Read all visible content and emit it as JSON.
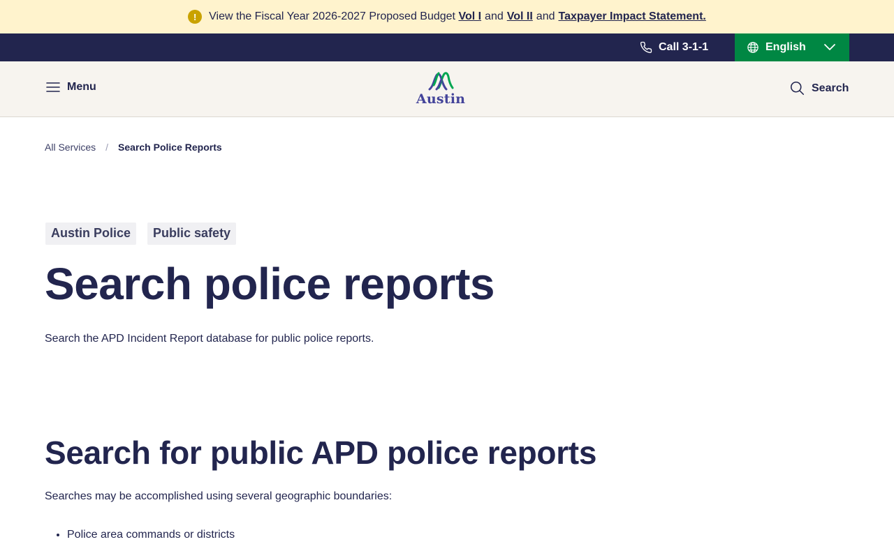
{
  "alert": {
    "icon": "exclamation-icon",
    "text": "View the Fiscal Year 2026-2027 Proposed Budget",
    "link1": "Vol I",
    "and1": "and",
    "link2": "Vol II",
    "and2": "and",
    "link3": "Taxpayer Impact Statement."
  },
  "utility": {
    "call_label": "Call 3-1-1",
    "language": "English"
  },
  "header": {
    "menu_label": "Menu",
    "logo_text": "Austin",
    "search_label": "Search"
  },
  "breadcrumb": {
    "items": [
      "All Services",
      "Search Police Reports"
    ],
    "separator": "/"
  },
  "tags": [
    "Austin Police",
    "Public safety"
  ],
  "page": {
    "title": "Search police reports",
    "intro": "Search the APD Incident Report database for public police reports."
  },
  "section": {
    "heading": "Search for public APD police reports",
    "text": "Searches may be accomplished using several geographic boundaries:",
    "bullets": [
      "Police area commands or districts"
    ]
  },
  "colors": {
    "alert_bg": "#fff3cd",
    "navy": "#22254e",
    "green": "#008743",
    "header_bg": "#f7f4ef"
  }
}
